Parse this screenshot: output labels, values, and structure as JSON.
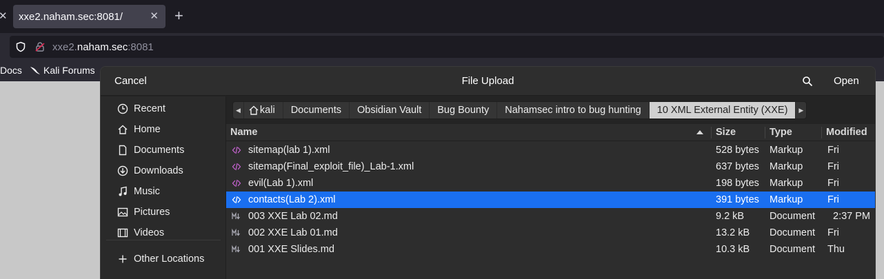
{
  "browser": {
    "tab_title": "xxe2.naham.sec:8081/",
    "url_sub": "xxe2.",
    "url_host": "naham.sec",
    "url_port": ":8081",
    "bookmarks": [
      "Docs",
      "Kali Forums"
    ]
  },
  "dialog": {
    "cancel_label": "Cancel",
    "title": "File Upload",
    "open_label": "Open",
    "sidebar": [
      {
        "label": "Recent",
        "icon": "clock-icon"
      },
      {
        "label": "Home",
        "icon": "home-icon"
      },
      {
        "label": "Documents",
        "icon": "document-icon"
      },
      {
        "label": "Downloads",
        "icon": "download-icon"
      },
      {
        "label": "Music",
        "icon": "music-icon"
      },
      {
        "label": "Pictures",
        "icon": "picture-icon"
      },
      {
        "label": "Videos",
        "icon": "video-icon"
      },
      {
        "label": "Other Locations",
        "icon": "plus-icon"
      }
    ],
    "breadcrumbs": [
      "kali",
      "Documents",
      "Obsidian Vault",
      "Bug Bounty",
      "Nahamsec intro to bug hunting",
      "10 XML External Entity (XXE)"
    ],
    "columns": {
      "name": "Name",
      "size": "Size",
      "type": "Type",
      "modified": "Modified"
    },
    "files": [
      {
        "name": "sitemap(lab 1).xml",
        "size": "528 bytes",
        "type": "Markup",
        "modified": "Fri",
        "icon": "xml-file-icon"
      },
      {
        "name": "sitemap(Final_exploit_file)_Lab-1.xml",
        "size": "637 bytes",
        "type": "Markup",
        "modified": "Fri",
        "icon": "xml-file-icon"
      },
      {
        "name": "evil(Lab 1).xml",
        "size": "198 bytes",
        "type": "Markup",
        "modified": "Fri",
        "icon": "xml-file-icon"
      },
      {
        "name": "contacts(Lab 2).xml",
        "size": "391 bytes",
        "type": "Markup",
        "modified": "Fri",
        "icon": "xml-file-icon",
        "selected": true
      },
      {
        "name": "003 XXE Lab 02.md",
        "size": "9.2 kB",
        "type": "Document",
        "modified": "2:37 PM",
        "icon": "markdown-file-icon"
      },
      {
        "name": "002 XXE Lab 01.md",
        "size": "13.2 kB",
        "type": "Document",
        "modified": "Fri",
        "icon": "markdown-file-icon"
      },
      {
        "name": "001 XXE Slides.md",
        "size": "10.3 kB",
        "type": "Document",
        "modified": "Thu",
        "icon": "markdown-file-icon"
      }
    ]
  },
  "colors": {
    "selection": "#1a6ff0",
    "xml_icon": "#c061cb"
  }
}
